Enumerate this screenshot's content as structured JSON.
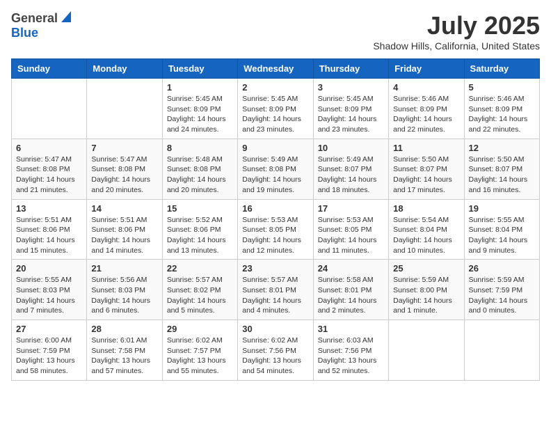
{
  "header": {
    "logo_general": "General",
    "logo_blue": "Blue",
    "month_title": "July 2025",
    "location": "Shadow Hills, California, United States"
  },
  "weekdays": [
    "Sunday",
    "Monday",
    "Tuesday",
    "Wednesday",
    "Thursday",
    "Friday",
    "Saturday"
  ],
  "weeks": [
    [
      {
        "day": "",
        "info": ""
      },
      {
        "day": "",
        "info": ""
      },
      {
        "day": "1",
        "info": "Sunrise: 5:45 AM\nSunset: 8:09 PM\nDaylight: 14 hours\nand 24 minutes."
      },
      {
        "day": "2",
        "info": "Sunrise: 5:45 AM\nSunset: 8:09 PM\nDaylight: 14 hours\nand 23 minutes."
      },
      {
        "day": "3",
        "info": "Sunrise: 5:45 AM\nSunset: 8:09 PM\nDaylight: 14 hours\nand 23 minutes."
      },
      {
        "day": "4",
        "info": "Sunrise: 5:46 AM\nSunset: 8:09 PM\nDaylight: 14 hours\nand 22 minutes."
      },
      {
        "day": "5",
        "info": "Sunrise: 5:46 AM\nSunset: 8:09 PM\nDaylight: 14 hours\nand 22 minutes."
      }
    ],
    [
      {
        "day": "6",
        "info": "Sunrise: 5:47 AM\nSunset: 8:08 PM\nDaylight: 14 hours\nand 21 minutes."
      },
      {
        "day": "7",
        "info": "Sunrise: 5:47 AM\nSunset: 8:08 PM\nDaylight: 14 hours\nand 20 minutes."
      },
      {
        "day": "8",
        "info": "Sunrise: 5:48 AM\nSunset: 8:08 PM\nDaylight: 14 hours\nand 20 minutes."
      },
      {
        "day": "9",
        "info": "Sunrise: 5:49 AM\nSunset: 8:08 PM\nDaylight: 14 hours\nand 19 minutes."
      },
      {
        "day": "10",
        "info": "Sunrise: 5:49 AM\nSunset: 8:07 PM\nDaylight: 14 hours\nand 18 minutes."
      },
      {
        "day": "11",
        "info": "Sunrise: 5:50 AM\nSunset: 8:07 PM\nDaylight: 14 hours\nand 17 minutes."
      },
      {
        "day": "12",
        "info": "Sunrise: 5:50 AM\nSunset: 8:07 PM\nDaylight: 14 hours\nand 16 minutes."
      }
    ],
    [
      {
        "day": "13",
        "info": "Sunrise: 5:51 AM\nSunset: 8:06 PM\nDaylight: 14 hours\nand 15 minutes."
      },
      {
        "day": "14",
        "info": "Sunrise: 5:51 AM\nSunset: 8:06 PM\nDaylight: 14 hours\nand 14 minutes."
      },
      {
        "day": "15",
        "info": "Sunrise: 5:52 AM\nSunset: 8:06 PM\nDaylight: 14 hours\nand 13 minutes."
      },
      {
        "day": "16",
        "info": "Sunrise: 5:53 AM\nSunset: 8:05 PM\nDaylight: 14 hours\nand 12 minutes."
      },
      {
        "day": "17",
        "info": "Sunrise: 5:53 AM\nSunset: 8:05 PM\nDaylight: 14 hours\nand 11 minutes."
      },
      {
        "day": "18",
        "info": "Sunrise: 5:54 AM\nSunset: 8:04 PM\nDaylight: 14 hours\nand 10 minutes."
      },
      {
        "day": "19",
        "info": "Sunrise: 5:55 AM\nSunset: 8:04 PM\nDaylight: 14 hours\nand 9 minutes."
      }
    ],
    [
      {
        "day": "20",
        "info": "Sunrise: 5:55 AM\nSunset: 8:03 PM\nDaylight: 14 hours\nand 7 minutes."
      },
      {
        "day": "21",
        "info": "Sunrise: 5:56 AM\nSunset: 8:03 PM\nDaylight: 14 hours\nand 6 minutes."
      },
      {
        "day": "22",
        "info": "Sunrise: 5:57 AM\nSunset: 8:02 PM\nDaylight: 14 hours\nand 5 minutes."
      },
      {
        "day": "23",
        "info": "Sunrise: 5:57 AM\nSunset: 8:01 PM\nDaylight: 14 hours\nand 4 minutes."
      },
      {
        "day": "24",
        "info": "Sunrise: 5:58 AM\nSunset: 8:01 PM\nDaylight: 14 hours\nand 2 minutes."
      },
      {
        "day": "25",
        "info": "Sunrise: 5:59 AM\nSunset: 8:00 PM\nDaylight: 14 hours\nand 1 minute."
      },
      {
        "day": "26",
        "info": "Sunrise: 5:59 AM\nSunset: 7:59 PM\nDaylight: 14 hours\nand 0 minutes."
      }
    ],
    [
      {
        "day": "27",
        "info": "Sunrise: 6:00 AM\nSunset: 7:59 PM\nDaylight: 13 hours\nand 58 minutes."
      },
      {
        "day": "28",
        "info": "Sunrise: 6:01 AM\nSunset: 7:58 PM\nDaylight: 13 hours\nand 57 minutes."
      },
      {
        "day": "29",
        "info": "Sunrise: 6:02 AM\nSunset: 7:57 PM\nDaylight: 13 hours\nand 55 minutes."
      },
      {
        "day": "30",
        "info": "Sunrise: 6:02 AM\nSunset: 7:56 PM\nDaylight: 13 hours\nand 54 minutes."
      },
      {
        "day": "31",
        "info": "Sunrise: 6:03 AM\nSunset: 7:56 PM\nDaylight: 13 hours\nand 52 minutes."
      },
      {
        "day": "",
        "info": ""
      },
      {
        "day": "",
        "info": ""
      }
    ]
  ]
}
